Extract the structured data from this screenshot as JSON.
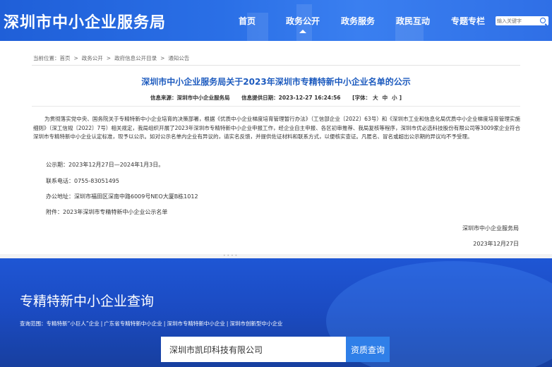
{
  "header": {
    "logo": "深圳市中小企业服务局",
    "nav": [
      {
        "label": "首页",
        "active": false
      },
      {
        "label": "政务公开",
        "active": true
      },
      {
        "label": "政务服务",
        "active": false
      },
      {
        "label": "政民互动",
        "active": false
      },
      {
        "label": "专题专栏",
        "active": false
      }
    ],
    "search_placeholder": "输入关键字"
  },
  "breadcrumb": {
    "prefix": "当前位置：",
    "items": [
      "首页",
      "政务公开",
      "政府信息公开目录",
      "通知公告"
    ],
    "sep": ">"
  },
  "article": {
    "title": "深圳市中小企业服务局关于2023年深圳市专精特新中小企业名单的公示",
    "source": "信息来源：深圳市中小企业服务局",
    "date": "信息提供日期：2023-12-27 16:24:56",
    "font_label": "[字体：",
    "font_sizes": [
      "大",
      "中",
      "小"
    ],
    "font_end": "]",
    "body": "为贯彻落实党中央、国务院关于专精特新中小企业培育的决策部署，根据《优质中小企业梯度培育管理暂行办法》（工信部企业〔2022〕63号）和《深圳市工业和信息化局优质中小企业梯度培育管理实施细则》（深工信规〔2022〕7号）相关规定，我局组织开展了2023年深圳市专精特新中小企业申报工作，经企业自主申报、各区初审推荐、我局复核等程序，深圳市优必选科技股份有限公司等3009家企业符合深圳市专精特新中小企业认定标准，现予以公示。如对公示名单内企业有异议的，请实名反馈，并提供佐证材料和联系方式，以便核实查证。凡匿名、冒名或超出公示期的异议均不予受理。",
    "period": "公示期：2023年12月27日—2024年1月3日。",
    "phone": "联系电话：0755-83051495",
    "address": "办公地址：深圳市福田区深南中路6009号NEO大厦B栋1012",
    "attachment": "附件：2023年深圳市专精特新中小企业公示名单",
    "signer": "深圳市中小企业服务局",
    "sign_date": "2023年12月27日"
  },
  "query": {
    "dots": "••••",
    "title": "专精特新中小企业查询",
    "scope_label": "查询范围：",
    "scopes": [
      "专精特新“小巨人”企业",
      "广东省专精特新中小企业",
      "深圳市专精特新中小企业",
      "深圳市创新型中小企业"
    ],
    "scope_sep": "|",
    "input_value": "深圳市凯印科技有限公司",
    "button": "资质查询"
  }
}
